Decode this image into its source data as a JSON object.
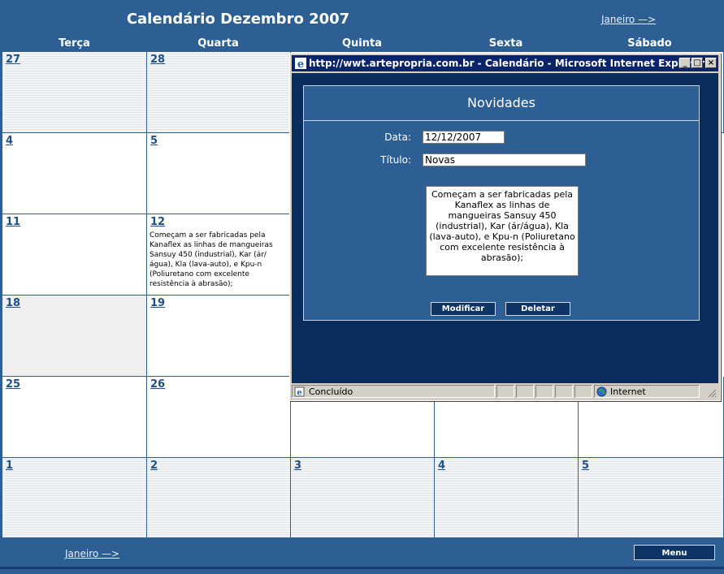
{
  "calendar": {
    "title": "Calendário Dezembro 2007",
    "next_link": "Janeiro —>",
    "day_headers": [
      "Terça",
      "Quarta",
      "Quinta",
      "Sexta",
      "Sábado"
    ],
    "weeks": [
      [
        "27",
        "28"
      ],
      [
        "4",
        "5"
      ],
      [
        "11",
        "12"
      ],
      [
        "18",
        "19"
      ],
      [
        "25",
        "26"
      ],
      [
        "1",
        "2",
        "3",
        "4",
        "5"
      ]
    ],
    "event_12": "Começam a ser fabricadas pela Kanaflex as linhas de mangueiras Sansuy 450 (industrial), Kar (ár/água), Kla (lava-auto), e Kpu-n (Poliuretano com excelente resistência à abrasão);"
  },
  "footer": {
    "next_link": "Janeiro —>",
    "menu_label": "Menu"
  },
  "popup": {
    "window_title": "http://wwt.artepropria.com.br - Calendário - Microsoft Internet Explorer",
    "heading": "Novidades",
    "date_label": "Data:",
    "date_value": "12/12/2007",
    "title_label": "Título:",
    "title_value": "Novas",
    "description": "Começam a ser fabricadas pela Kanaflex as linhas de mangueiras Sansuy 450 (industrial), Kar (ár/água), Kla (lava-auto), e Kpu-n (Poliuretano com excelente resistência à abrasão);",
    "modify_label": "Modificar",
    "delete_label": "Deletar",
    "status_text": "Concluído",
    "zone_text": "Internet"
  },
  "colors": {
    "header_blue": "#2e5f94",
    "popup_navy": "#0a2d5e",
    "titlebar": "#0a246a"
  }
}
